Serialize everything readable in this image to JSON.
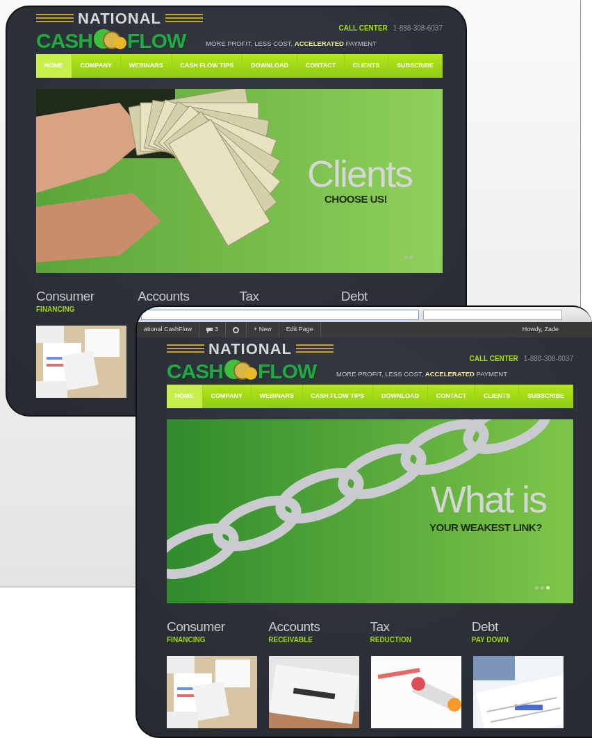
{
  "screens": [
    {
      "logo": {
        "top": "NATIONAL",
        "left": "CASH",
        "right": "FLOW",
        "tagline": "MORE PROFIT, LESS COST, **ACCELERATED** PAYMENT"
      },
      "call_center": {
        "label": "CALL CENTER",
        "phone": "1-888-308-6037"
      },
      "nav": [
        {
          "label": "HOME",
          "selected": true
        },
        {
          "label": "COMPANY",
          "selected": false
        },
        {
          "label": "WEBINARS",
          "selected": false
        },
        {
          "label": "CASH FLOW TIPS",
          "selected": false
        },
        {
          "label": "DOWNLOAD",
          "selected": false
        },
        {
          "label": "CONTACT",
          "selected": false
        },
        {
          "label": "CLIENTS",
          "selected": false
        },
        {
          "label": "SUBSCRIBE",
          "selected": false
        }
      ],
      "hero": {
        "kind": "picture",
        "headline": "Clients",
        "subhead": "CHOOSE US!",
        "dots": [
          {
            "selected": false
          },
          {
            "selected": false
          }
        ]
      },
      "features": [
        {
          "title": "Consumer",
          "subtitle": "FINANCING"
        },
        {
          "title": "Accounts"
        },
        {
          "title": "Tax"
        },
        {
          "title": "Debt"
        }
      ]
    },
    {
      "browser": {
        "toolbar": [
          {
            "label": "ational CashFlow"
          },
          {
            "label": "3"
          },
          {
            "label": "+ New"
          },
          {
            "label": "Edit Page"
          }
        ],
        "greeting": "Howdy, Zade"
      },
      "logo": {
        "top": "NATIONAL",
        "left": "CASH",
        "right": "FLOW",
        "tagline": "MORE PROFIT, LESS COST, **ACCELERATED** PAYMENT"
      },
      "call_center": {
        "label": "CALL CENTER",
        "phone": "1-888-308-6037"
      },
      "nav": [
        {
          "label": "HOME",
          "selected": true
        },
        {
          "label": "COMPANY",
          "selected": false
        },
        {
          "label": "WEBINARS",
          "selected": false
        },
        {
          "label": "CASH FLOW TIPS",
          "selected": false
        },
        {
          "label": "DOWNLOAD",
          "selected": false
        },
        {
          "label": "CONTACT",
          "selected": false
        },
        {
          "label": "CLIENTS",
          "selected": false
        },
        {
          "label": "SUBSCRIBE",
          "selected": false
        }
      ],
      "hero": {
        "kind": "picture",
        "headline": "What is",
        "subhead": "YOUR WEAKEST LINK?",
        "dots": [
          {
            "selected": false
          },
          {
            "selected": false
          },
          {
            "selected": true
          }
        ]
      },
      "features": [
        {
          "title": "Consumer",
          "subtitle": "FINANCING"
        },
        {
          "title": "Accounts",
          "subtitle": "RECEIVABLE"
        },
        {
          "title": "Tax",
          "subtitle": "REDUCTION"
        },
        {
          "title": "Debt",
          "subtitle": "PAY DOWN"
        }
      ]
    }
  ]
}
